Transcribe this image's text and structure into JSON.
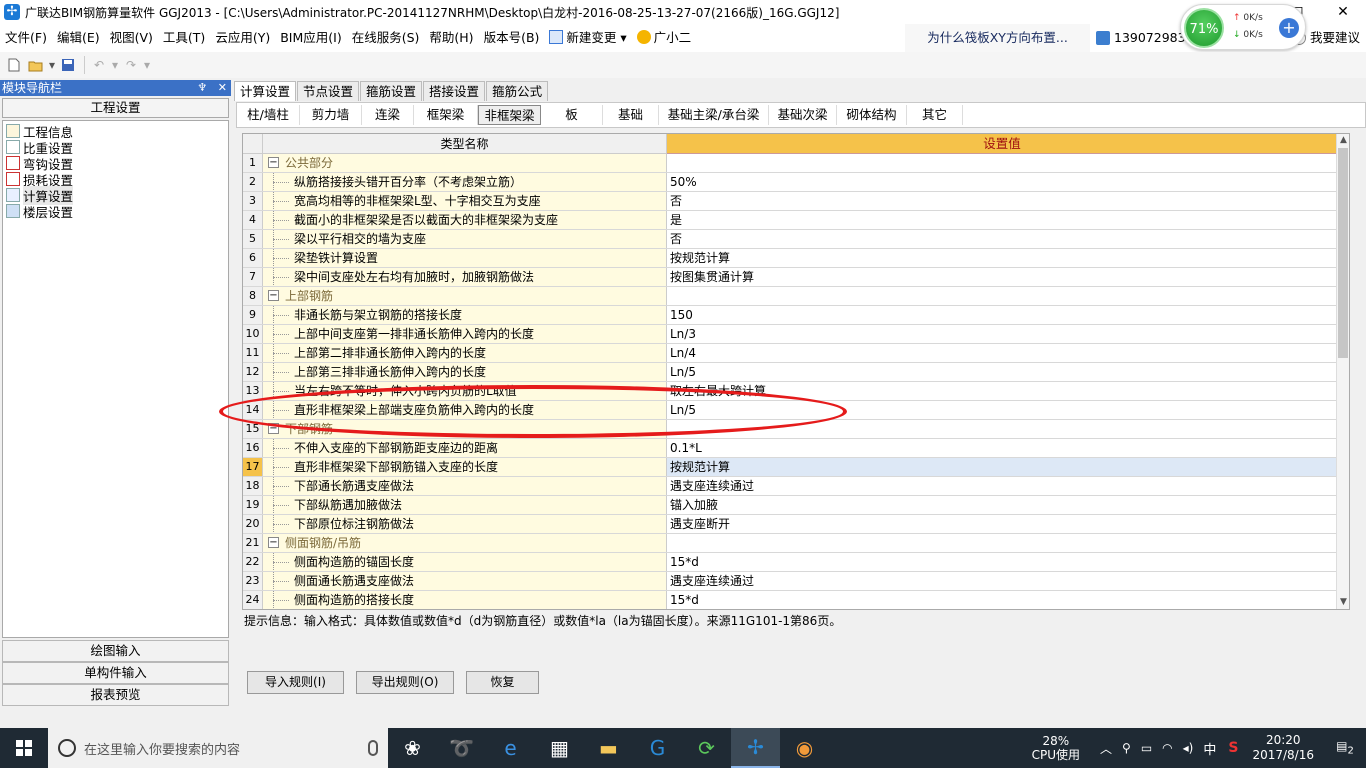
{
  "window": {
    "title": "广联达BIM钢筋算量软件 GGJ2013 - [C:\\Users\\Administrator.PC-20141127NRHM\\Desktop\\白龙村-2016-08-25-13-27-07(2166版)_16G.GGJ12]",
    "min": "—",
    "max": "□",
    "close": "✕"
  },
  "menu": [
    "文件(F)",
    "编辑(E)",
    "视图(V)",
    "工具(T)",
    "云应用(Y)",
    "BIM应用(I)",
    "在线服务(S)",
    "帮助(H)",
    "版本号(B)",
    "新建变更",
    "广小二"
  ],
  "ad": "为什么筏板XY方向布置...",
  "phone": "1390729833",
  "suggest": "我要建议",
  "net": {
    "percent": "71%",
    "up": "0K/s",
    "down": "0K/s"
  },
  "nav": {
    "header": "模块导航栏",
    "pin": "♆",
    "close": "✕",
    "section": "工程设置",
    "items": [
      "工程信息",
      "比重设置",
      "弯钩设置",
      "损耗设置",
      "计算设置",
      "楼层设置"
    ],
    "bottom": [
      "绘图输入",
      "单构件输入",
      "报表预览"
    ]
  },
  "tabs1": [
    "计算设置",
    "节点设置",
    "箍筋设置",
    "搭接设置",
    "箍筋公式"
  ],
  "tabs2": [
    "柱/墙柱",
    "剪力墙",
    "连梁",
    "框架梁",
    "非框架梁",
    "板",
    "基础",
    "基础主梁/承台梁",
    "基础次梁",
    "砌体结构",
    "其它"
  ],
  "grid": {
    "col1": "类型名称",
    "col2": "设置值",
    "rows": [
      {
        "n": "1",
        "name": "公共部分",
        "val": "",
        "grp": true
      },
      {
        "n": "2",
        "name": "纵筋搭接接头错开百分率（不考虑架立筋）",
        "val": "50%"
      },
      {
        "n": "3",
        "name": "宽高均相等的非框架梁L型、十字相交互为支座",
        "val": "否"
      },
      {
        "n": "4",
        "name": "截面小的非框架梁是否以截面大的非框架梁为支座",
        "val": "是"
      },
      {
        "n": "5",
        "name": "梁以平行相交的墙为支座",
        "val": "否"
      },
      {
        "n": "6",
        "name": "梁垫铁计算设置",
        "val": "按规范计算"
      },
      {
        "n": "7",
        "name": "梁中间支座处左右均有加腋时，加腋钢筋做法",
        "val": "按图集贯通计算"
      },
      {
        "n": "8",
        "name": "上部钢筋",
        "val": "",
        "grp": true
      },
      {
        "n": "9",
        "name": "非通长筋与架立钢筋的搭接长度",
        "val": "150"
      },
      {
        "n": "10",
        "name": "上部中间支座第一排非通长筋伸入跨内的长度",
        "val": "Ln/3"
      },
      {
        "n": "11",
        "name": "上部第二排非通长筋伸入跨内的长度",
        "val": "Ln/4"
      },
      {
        "n": "12",
        "name": "上部第三排非通长筋伸入跨内的长度",
        "val": "Ln/5"
      },
      {
        "n": "13",
        "name": "当左右跨不等时，伸入小跨内负筋的L取值",
        "val": "取左右最大跨计算"
      },
      {
        "n": "14",
        "name": "直形非框架梁上部端支座负筋伸入跨内的长度",
        "val": "Ln/5"
      },
      {
        "n": "15",
        "name": "下部钢筋",
        "val": "",
        "grp": true
      },
      {
        "n": "16",
        "name": "不伸入支座的下部钢筋距支座边的距离",
        "val": "0.1*L"
      },
      {
        "n": "17",
        "name": "直形非框架梁下部钢筋锚入支座的长度",
        "val": "按规范计算",
        "sel": true
      },
      {
        "n": "18",
        "name": "下部通长筋遇支座做法",
        "val": "遇支座连续通过"
      },
      {
        "n": "19",
        "name": "下部纵筋遇加腋做法",
        "val": "锚入加腋"
      },
      {
        "n": "20",
        "name": "下部原位标注钢筋做法",
        "val": "遇支座断开"
      },
      {
        "n": "21",
        "name": "侧面钢筋/吊筋",
        "val": "",
        "grp": true
      },
      {
        "n": "22",
        "name": "侧面构造筋的锚固长度",
        "val": "15*d"
      },
      {
        "n": "23",
        "name": "侧面通长筋遇支座做法",
        "val": "遇支座连续通过"
      },
      {
        "n": "24",
        "name": "侧面构造筋的搭接长度",
        "val": "15*d"
      }
    ]
  },
  "hint": "提示信息：输入格式：具体数值或数值*d（d为钢筋直径）或数值*la（la为锚固长度）。来源11G101-1第86页。",
  "buttons": [
    "导入规则(I)",
    "导出规则(O)",
    "恢复"
  ],
  "taskbar": {
    "search": "在这里输入你要搜索的内容",
    "cpu_pct": "28%",
    "cpu_label": "CPU使用",
    "ime": "中",
    "time": "20:20",
    "date": "2017/8/16",
    "notif": "2"
  }
}
